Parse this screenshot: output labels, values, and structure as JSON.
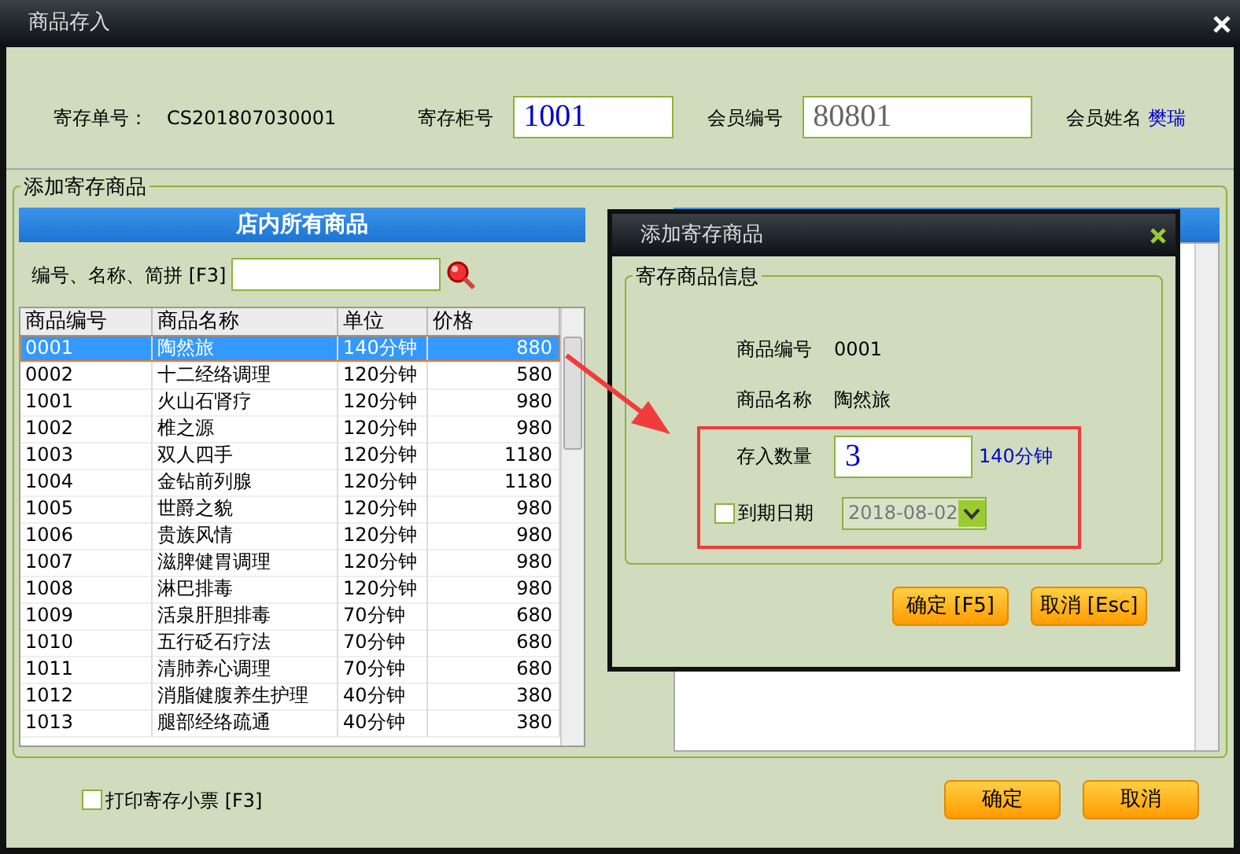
{
  "window": {
    "title": "商品存入"
  },
  "header": {
    "order_label": "寄存单号：",
    "order_no": "CS201807030001",
    "locker_label": "寄存柜号",
    "locker_value": "1001",
    "member_label": "会员编号",
    "member_value": "80801",
    "member_name_label": "会员姓名",
    "member_name": "樊瑞"
  },
  "group": {
    "title": "添加寄存商品"
  },
  "all_goods": {
    "title": "店内所有商品",
    "search_label": "编号、名称、简拼 [F3]",
    "columns": [
      "商品编号",
      "商品名称",
      "单位",
      "价格"
    ],
    "rows": [
      {
        "cells": [
          "0001",
          "陶然旅",
          "140分钟",
          "880"
        ],
        "selected": true
      },
      {
        "cells": [
          "0002",
          "十二经络调理",
          "120分钟",
          "580"
        ],
        "selected": false
      },
      {
        "cells": [
          "1001",
          "火山石肾疗",
          "120分钟",
          "980"
        ],
        "selected": false
      },
      {
        "cells": [
          "1002",
          "椎之源",
          "120分钟",
          "980"
        ],
        "selected": false
      },
      {
        "cells": [
          "1003",
          "双人四手",
          "120分钟",
          "1180"
        ],
        "selected": false
      },
      {
        "cells": [
          "1004",
          "金钻前列腺",
          "120分钟",
          "1180"
        ],
        "selected": false
      },
      {
        "cells": [
          "1005",
          "世爵之貌",
          "120分钟",
          "980"
        ],
        "selected": false
      },
      {
        "cells": [
          "1006",
          "贵族风情",
          "120分钟",
          "980"
        ],
        "selected": false
      },
      {
        "cells": [
          "1007",
          "滋脾健胃调理",
          "120分钟",
          "980"
        ],
        "selected": false
      },
      {
        "cells": [
          "1008",
          "淋巴排毒",
          "120分钟",
          "980"
        ],
        "selected": false
      },
      {
        "cells": [
          "1009",
          "活泉肝胆排毒",
          "70分钟",
          "680"
        ],
        "selected": false
      },
      {
        "cells": [
          "1010",
          "五行砭石疗法",
          "70分钟",
          "680"
        ],
        "selected": false
      },
      {
        "cells": [
          "1011",
          "清肺养心调理",
          "70分钟",
          "680"
        ],
        "selected": false
      },
      {
        "cells": [
          "1012",
          "消脂健腹养生护理",
          "40分钟",
          "380"
        ],
        "selected": false
      },
      {
        "cells": [
          "1013",
          "腿部经络疏通",
          "40分钟",
          "380"
        ],
        "selected": false
      }
    ]
  },
  "dialog": {
    "title": "添加寄存商品",
    "group_title": "寄存商品信息",
    "code_label": "商品编号",
    "code_value": "0001",
    "name_label": "商品名称",
    "name_value": "陶然旅",
    "qty_label": "存入数量",
    "qty_value": "3",
    "unit": "140分钟",
    "expiry": {
      "label": "到期日期",
      "checked": false,
      "value": "2018-08-02"
    },
    "buttons": [
      "确定 [F5]",
      "取消 [Esc]"
    ]
  },
  "print_ticket": {
    "label": "打印寄存小票 [F3]",
    "checked": false
  },
  "buttons": [
    "确定",
    "取消"
  ]
}
